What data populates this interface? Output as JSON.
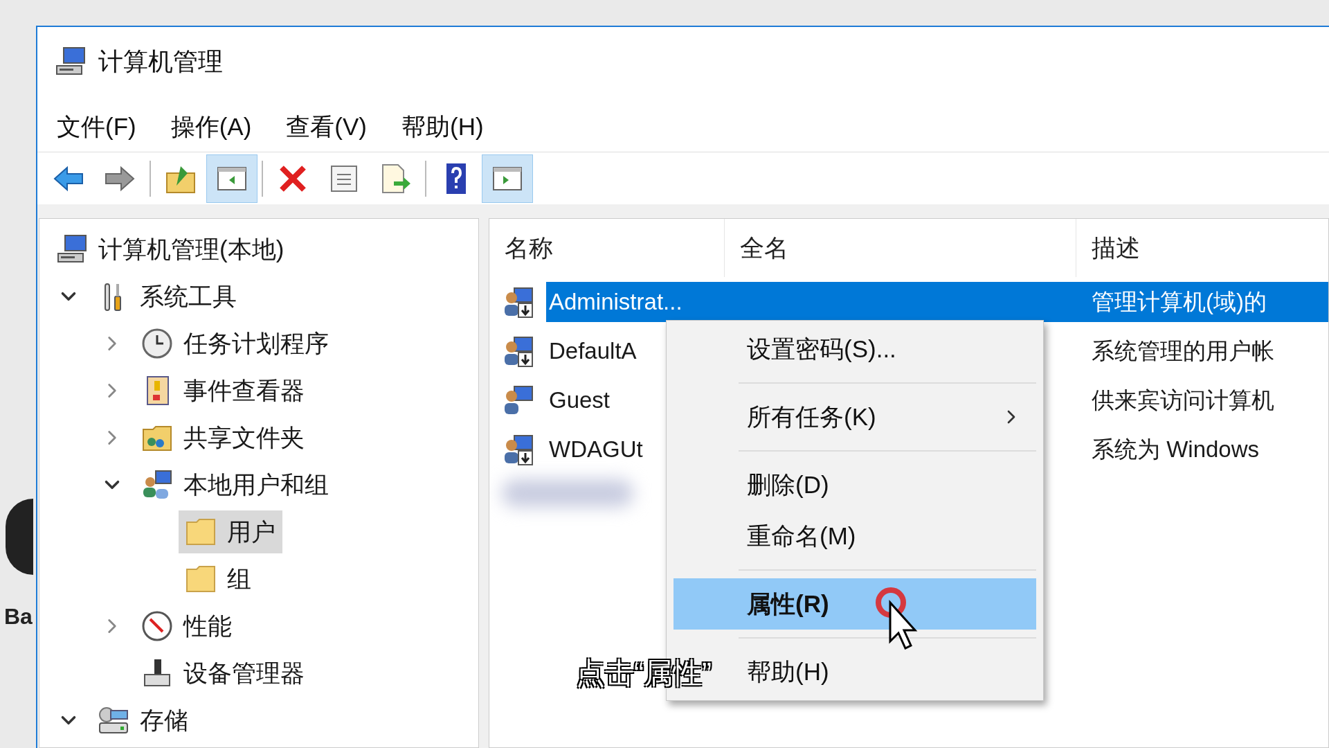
{
  "desktop": {
    "label": "Ba"
  },
  "window": {
    "title": "计算机管理"
  },
  "menu_bar": [
    "文件(F)",
    "操作(A)",
    "查看(V)",
    "帮助(H)"
  ],
  "toolbar": [
    {
      "kind": "back",
      "on": false
    },
    {
      "kind": "forward",
      "on": false
    },
    {
      "kind": "separator"
    },
    {
      "kind": "up",
      "on": false
    },
    {
      "kind": "tree",
      "on": true
    },
    {
      "kind": "separator"
    },
    {
      "kind": "delete",
      "on": false
    },
    {
      "kind": "properties",
      "on": false
    },
    {
      "kind": "export",
      "on": false
    },
    {
      "kind": "separator"
    },
    {
      "kind": "help",
      "on": false
    },
    {
      "kind": "pane",
      "on": true
    }
  ],
  "tree": [
    {
      "label": "计算机管理(本地)",
      "kind": "computer",
      "expandable": false,
      "expanded": true,
      "selected": false,
      "children": [
        {
          "label": "系统工具",
          "kind": "tools",
          "expandable": true,
          "expanded": true,
          "selected": false,
          "children": [
            {
              "label": "任务计划程序",
              "kind": "clock",
              "expandable": true,
              "expanded": false,
              "selected": false
            },
            {
              "label": "事件查看器",
              "kind": "log",
              "expandable": true,
              "expanded": false,
              "selected": false
            },
            {
              "label": "共享文件夹",
              "kind": "share",
              "expandable": true,
              "expanded": false,
              "selected": false
            },
            {
              "label": "本地用户和组",
              "kind": "users",
              "expandable": true,
              "expanded": true,
              "selected": false,
              "children": [
                {
                  "label": "用户",
                  "kind": "folder",
                  "expandable": false,
                  "selected": true
                },
                {
                  "label": "组",
                  "kind": "folder",
                  "expandable": false,
                  "selected": false
                }
              ]
            },
            {
              "label": "性能",
              "kind": "gauge",
              "expandable": true,
              "expanded": false,
              "selected": false
            },
            {
              "label": "设备管理器",
              "kind": "device",
              "expandable": false,
              "selected": false
            }
          ]
        },
        {
          "label": "存储",
          "kind": "storage",
          "expandable": true,
          "expanded": true,
          "selected": false
        }
      ]
    }
  ],
  "table": {
    "columns": [
      "名称",
      "全名",
      "描述"
    ],
    "rows": [
      {
        "name": "Administrat...",
        "description": "管理计算机(域)的",
        "disabled": true,
        "selected": true
      },
      {
        "name": "DefaultA",
        "description": "系统管理的用户帐",
        "disabled": true,
        "selected": false
      },
      {
        "name": "Guest",
        "description": "供来宾访问计算机",
        "disabled": false,
        "selected": false
      },
      {
        "name": "WDAGUt",
        "description": "系统为 Windows",
        "disabled": true,
        "selected": false
      }
    ]
  },
  "context_menu": {
    "items": [
      {
        "kind": "item",
        "label": "设置密码(S)...",
        "submenu": false,
        "selected": false
      },
      {
        "kind": "separator"
      },
      {
        "kind": "item",
        "label": "所有任务(K)",
        "submenu": true,
        "selected": false
      },
      {
        "kind": "separator"
      },
      {
        "kind": "item",
        "label": "删除(D)",
        "submenu": false,
        "selected": false
      },
      {
        "kind": "item",
        "label": "重命名(M)",
        "submenu": false,
        "selected": false
      },
      {
        "kind": "separator"
      },
      {
        "kind": "item",
        "label": "属性(R)",
        "submenu": false,
        "selected": true
      },
      {
        "kind": "separator"
      },
      {
        "kind": "item",
        "label": "帮助(H)",
        "submenu": false,
        "selected": false
      }
    ]
  },
  "caption": "点击“属性”"
}
